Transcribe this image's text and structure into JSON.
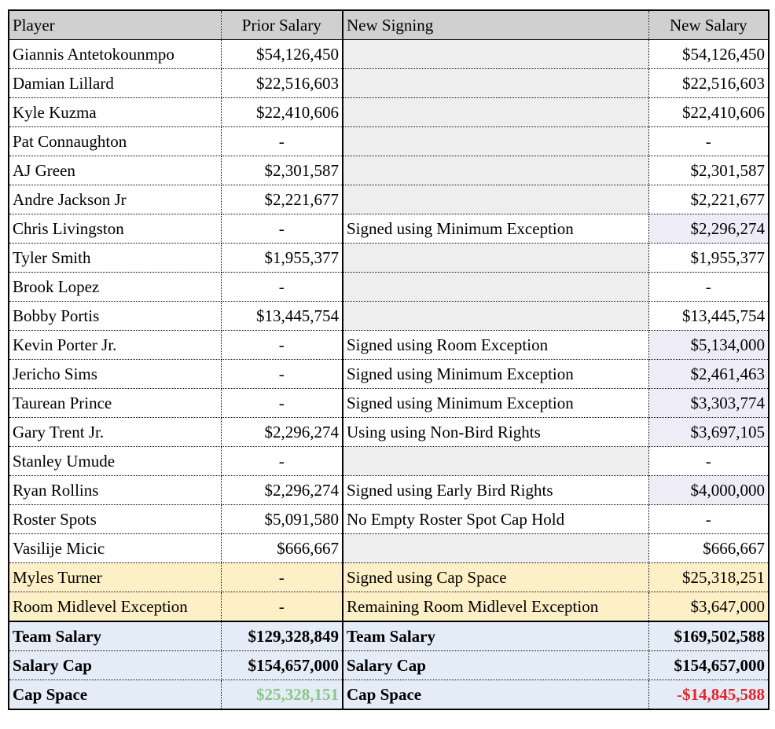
{
  "headers": {
    "player": "Player",
    "prior_salary": "Prior Salary",
    "new_signing": "New Signing",
    "new_salary": "New Salary"
  },
  "rows": [
    {
      "player": "Giannis Antetokounmpo",
      "prior": "$54,126,450",
      "signing": "",
      "new": "$54,126,450",
      "style": "gray"
    },
    {
      "player": "Damian Lillard",
      "prior": "$22,516,603",
      "signing": "",
      "new": "$22,516,603",
      "style": "gray"
    },
    {
      "player": "Kyle Kuzma",
      "prior": "$22,410,606",
      "signing": "",
      "new": "$22,410,606",
      "style": "gray"
    },
    {
      "player": "Pat Connaughton",
      "prior": "-",
      "signing": "",
      "new": "-",
      "style": "gray"
    },
    {
      "player": "AJ Green",
      "prior": "$2,301,587",
      "signing": "",
      "new": "$2,301,587",
      "style": "gray"
    },
    {
      "player": "Andre Jackson Jr",
      "prior": "$2,221,677",
      "signing": "",
      "new": "$2,221,677",
      "style": "gray"
    },
    {
      "player": "Chris Livingston",
      "prior": "-",
      "signing": "Signed using Minimum Exception",
      "new": "$2,296,274",
      "style": "lav"
    },
    {
      "player": "Tyler Smith",
      "prior": "$1,955,377",
      "signing": "",
      "new": "$1,955,377",
      "style": "gray"
    },
    {
      "player": "Brook Lopez",
      "prior": "-",
      "signing": "",
      "new": "-",
      "style": "gray"
    },
    {
      "player": "Bobby Portis",
      "prior": "$13,445,754",
      "signing": "",
      "new": "$13,445,754",
      "style": "gray"
    },
    {
      "player": "Kevin Porter Jr.",
      "prior": "-",
      "signing": "Signed using Room Exception",
      "new": "$5,134,000",
      "style": "lav"
    },
    {
      "player": "Jericho Sims",
      "prior": "-",
      "signing": "Signed using Minimum Exception",
      "new": "$2,461,463",
      "style": "lav"
    },
    {
      "player": "Taurean Prince",
      "prior": "-",
      "signing": "Signed using Minimum Exception",
      "new": "$3,303,774",
      "style": "lav"
    },
    {
      "player": "Gary Trent Jr.",
      "prior": "$2,296,274",
      "signing": "Using using Non-Bird Rights",
      "new": "$3,697,105",
      "style": "lav"
    },
    {
      "player": "Stanley Umude",
      "prior": "-",
      "signing": "",
      "new": "-",
      "style": "gray"
    },
    {
      "player": "Ryan Rollins",
      "prior": "$2,296,274",
      "signing": "Signed using Early Bird Rights",
      "new": "$4,000,000",
      "style": "lav"
    },
    {
      "player": "Roster Spots",
      "prior": "$5,091,580",
      "signing": "No Empty Roster Spot Cap Hold",
      "new": "-",
      "style": "plain"
    },
    {
      "player": "Vasilije Micic",
      "prior": "$666,667",
      "signing": "",
      "new": "$666,667",
      "style": "gray"
    },
    {
      "player": "Myles Turner",
      "prior": "-",
      "signing": "Signed using Cap Space",
      "new": "$25,318,251",
      "style": "yellow"
    },
    {
      "player": "Room Midlevel Exception",
      "prior": "-",
      "signing": "Remaining Room Midlevel Exception",
      "new": "$3,647,000",
      "style": "yellow"
    }
  ],
  "summary": [
    {
      "label": "Team Salary",
      "prior": "$129,328,849",
      "label2": "Team Salary",
      "new": "$169,502,588",
      "prior_color": "",
      "new_color": ""
    },
    {
      "label": "Salary Cap",
      "prior": "$154,657,000",
      "label2": "Salary Cap",
      "new": "$154,657,000",
      "prior_color": "",
      "new_color": ""
    },
    {
      "label": "Cap Space",
      "prior": "$25,328,151",
      "label2": "Cap Space",
      "new": "-$14,845,588",
      "prior_color": "#8ec485",
      "new_color": "#e8222a"
    }
  ]
}
